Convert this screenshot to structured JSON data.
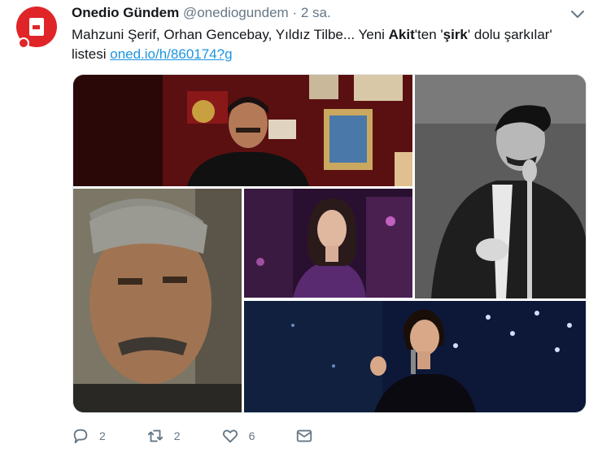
{
  "tweet": {
    "author_name": "Onedio Gündem",
    "handle": "@onediogundem",
    "separator": "·",
    "time": "2 sa.",
    "text_part1": "Mahzuni Şerif, Orhan Gencebay, Yıldız Tilbe... Yeni ",
    "text_bold1": "Akit",
    "text_part2": "'ten '",
    "text_bold2": "şirk",
    "text_part3": "' dolu şarkılar' listesi ",
    "link": "oned.io/h/860174?g"
  },
  "actions": {
    "reply_count": "2",
    "retweet_count": "2",
    "like_count": "6"
  },
  "icons": {
    "reply": "reply-icon",
    "retweet": "retweet-icon",
    "like": "heart-icon",
    "dm": "envelope-icon",
    "menu": "chevron-down-icon"
  },
  "colors": {
    "link": "#1b95e0",
    "muted": "#657786",
    "avatar": "#e02529"
  }
}
